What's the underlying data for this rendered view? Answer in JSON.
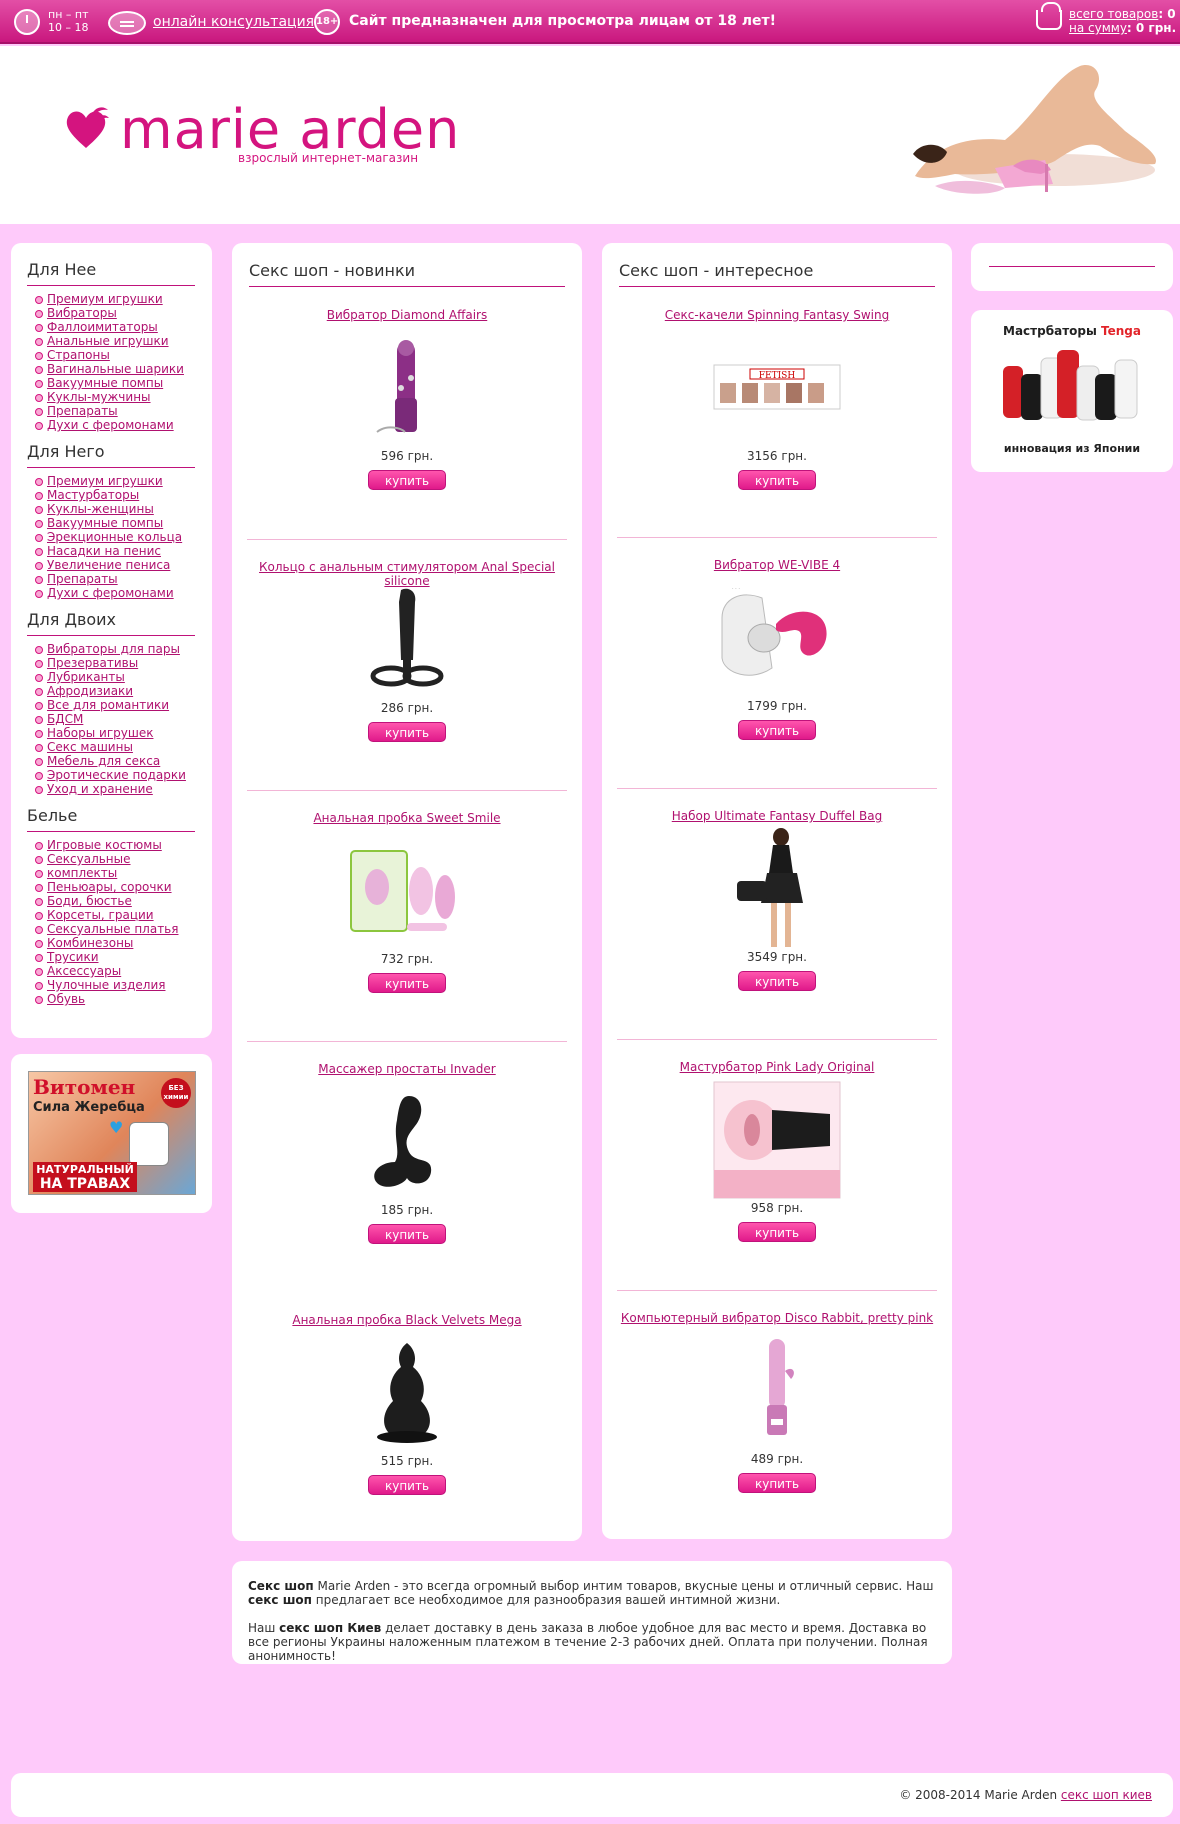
{
  "topbar": {
    "hours_line1": "пн – пт",
    "hours_line2": "10 – 18",
    "consultation": "онлайн консультация",
    "age_badge": "18+",
    "warning": "Сайт предназначен для просмотра лицам от 18 лет!",
    "cart_items_label": "всего товаров",
    "cart_items_value": ": 0",
    "cart_sum_label": "на сумму",
    "cart_sum_value": ": 0 грн."
  },
  "header": {
    "logo_name": "marie arden",
    "logo_sub": "взрослый интернет-магазин",
    "brand_color": "#d4147f"
  },
  "sidebar": {
    "sections": [
      {
        "title": "Для Нее",
        "items": [
          "Премиум игрушки",
          "Вибраторы",
          "Фаллоимитаторы",
          "Анальные игрушки",
          "Страпоны",
          "Вагинальные шарики",
          "Вакуумные помпы",
          "Куклы-мужчины",
          "Препараты",
          "Духи с феромонами"
        ]
      },
      {
        "title": "Для Него",
        "items": [
          "Премиум игрушки",
          "Мастурбаторы",
          "Куклы-женщины",
          "Вакуумные помпы",
          "Эрекционные кольца",
          "Насадки на пенис",
          "Увеличение пениса",
          "Препараты",
          "Духи с феромонами"
        ]
      },
      {
        "title": "Для Двоих",
        "items": [
          "Вибраторы для пары",
          "Презервативы",
          "Лубриканты",
          "Афродизиаки",
          "Все для романтики",
          "БДСМ",
          "Наборы игрушек",
          "Секс машины",
          "Мебель для секса",
          "Эротические подарки",
          "Уход и хранение"
        ]
      },
      {
        "title": "Белье",
        "items": [
          "Игровые костюмы",
          "Сексуальные",
          "комплекты",
          "Пеньюары, сорочки",
          "Боди, бюстье",
          "Корсеты, грации",
          "Сексуальные платья",
          "Комбинезоны",
          "Трусики",
          "Аксессуары",
          "Чулочные изделия",
          "Обувь"
        ]
      }
    ],
    "banner": {
      "title": "Витомен",
      "subtitle": "Сила Жеребца",
      "badge": "БЕЗ химии",
      "footer_line1": "НАТУРАЛЬНЫЙ",
      "footer_line2": "НА ТРАВАХ"
    }
  },
  "new_column": {
    "title": "Секс шоп - новинки",
    "products": [
      {
        "name": "Вибратор Diamond Affairs",
        "price": "596 грн.",
        "buy": "купить"
      },
      {
        "name": "Кольцо с анальным стимулятором Anal Special silicone",
        "price": "286 грн.",
        "buy": "купить"
      },
      {
        "name": "Анальная пробка Sweet Smile",
        "price": "732 грн.",
        "buy": "купить"
      },
      {
        "name": "Массажер простаты Invader",
        "price": "185 грн.",
        "buy": "купить"
      },
      {
        "name": "Анальная пробка Black Velvets Mega",
        "price": "515 грн.",
        "buy": "купить"
      }
    ]
  },
  "interesting_column": {
    "title": "Секс шоп - интересное",
    "products": [
      {
        "name": "Секс-качели Spinning Fantasy Swing",
        "price": "3156 грн.",
        "buy": "купить"
      },
      {
        "name": "Вибратор WE-VIBE 4",
        "price": "1799 грн.",
        "buy": "купить"
      },
      {
        "name": "Набор Ultimate Fantasy Duffel Bag",
        "price": "3549 грн.",
        "buy": "купить"
      },
      {
        "name": "Мастурбатор Pink Lady Original",
        "price": "958 грн.",
        "buy": "купить"
      },
      {
        "name": "Компьютерный вибратор Disco Rabbit, pretty pink",
        "price": "489 грн.",
        "buy": "купить"
      }
    ]
  },
  "right_banner": {
    "title_a": "Мастрбаторы ",
    "title_b": "Tenga",
    "caption": "инновация из Японии"
  },
  "description": {
    "p1_b1": "Секс шоп",
    "p1_t1": " Marie Arden - это всегда огромный выбор интим товаров, вкусные цены и отличный сервис. Наш ",
    "p1_b2": "секс шоп",
    "p1_t2": " предлагает все необходимое для разнообразия вашей интимной жизни.",
    "p2_t1": "Наш ",
    "p2_b1": "секс шоп Киев",
    "p2_t2": " делает доставку в день заказа в любое удобное для вас место и время. Доставка во все регионы Украины наложенным платежом в течение 2-3 рабочих дней. Оплата при получении. Полная анонимность!"
  },
  "footer": {
    "copyright": "© 2008-2014 Marie Arden ",
    "link": "секс шоп киев"
  }
}
